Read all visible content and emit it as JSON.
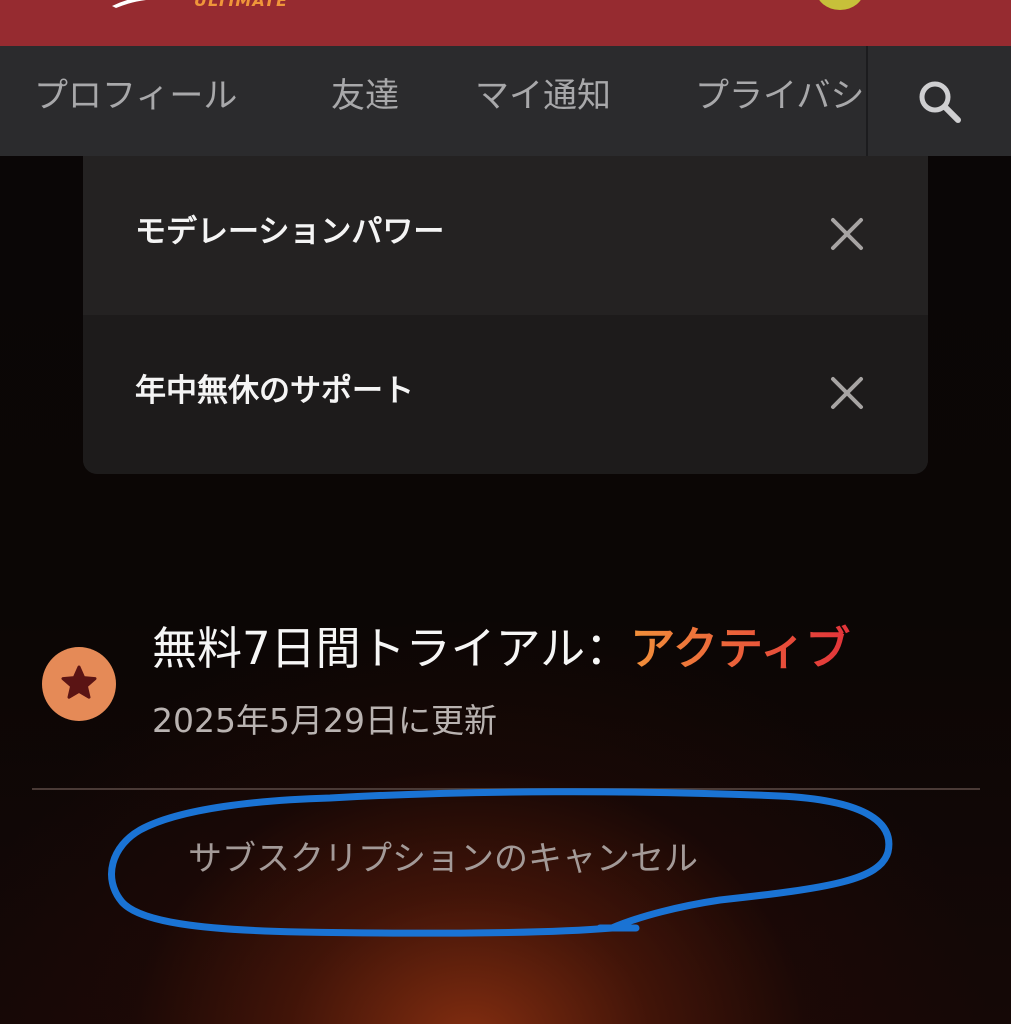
{
  "header": {
    "brand_tag": "ULTIMATE",
    "background_color": "#962b30",
    "accent_color": "#f0963a"
  },
  "tabs": [
    {
      "label": "プロフィール"
    },
    {
      "label": "友達"
    },
    {
      "label": "マイ通知"
    },
    {
      "label": "プライバシ"
    }
  ],
  "search": {
    "icon": "search-icon"
  },
  "features": [
    {
      "label": "モデレーションパワー",
      "icon": "close-icon"
    },
    {
      "label": "年中無休のサポート",
      "icon": "close-icon"
    }
  ],
  "subscription": {
    "badge_icon": "star-icon",
    "title_prefix": "無料7日間トライアル：",
    "status": "アクティブ",
    "renewal": "2025年5月29日に更新",
    "cancel_label": "サブスクリプションのキャンセル"
  },
  "colors": {
    "status_gradient_start": "#f2913a",
    "status_gradient_end": "#e2333a",
    "badge": "#e58a57",
    "annotation_stroke": "#1a73d4"
  }
}
